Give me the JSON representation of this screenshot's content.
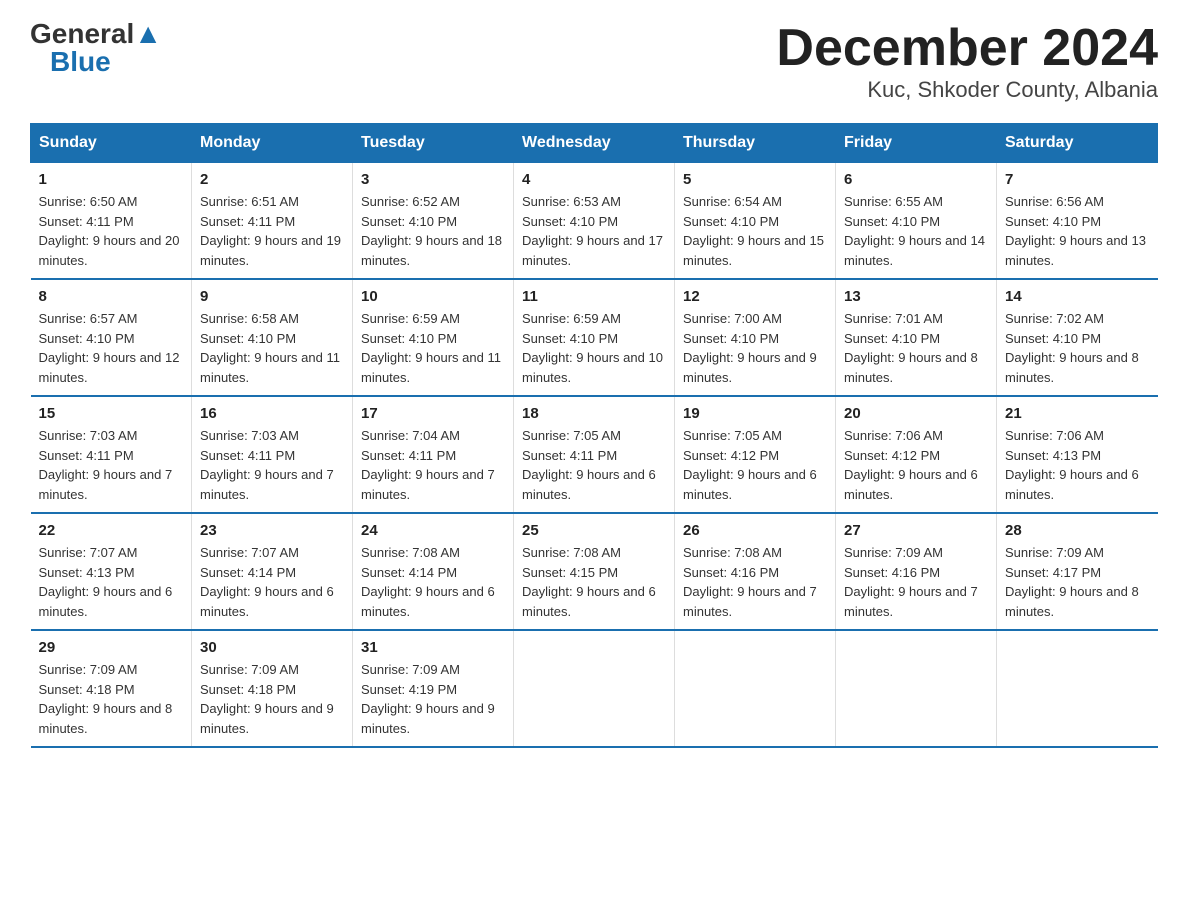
{
  "header": {
    "logo_general": "General",
    "logo_blue": "Blue",
    "title": "December 2024",
    "subtitle": "Kuc, Shkoder County, Albania"
  },
  "days_of_week": [
    "Sunday",
    "Monday",
    "Tuesday",
    "Wednesday",
    "Thursday",
    "Friday",
    "Saturday"
  ],
  "weeks": [
    [
      {
        "day": "1",
        "sunrise": "6:50 AM",
        "sunset": "4:11 PM",
        "daylight": "9 hours and 20 minutes."
      },
      {
        "day": "2",
        "sunrise": "6:51 AM",
        "sunset": "4:11 PM",
        "daylight": "9 hours and 19 minutes."
      },
      {
        "day": "3",
        "sunrise": "6:52 AM",
        "sunset": "4:10 PM",
        "daylight": "9 hours and 18 minutes."
      },
      {
        "day": "4",
        "sunrise": "6:53 AM",
        "sunset": "4:10 PM",
        "daylight": "9 hours and 17 minutes."
      },
      {
        "day": "5",
        "sunrise": "6:54 AM",
        "sunset": "4:10 PM",
        "daylight": "9 hours and 15 minutes."
      },
      {
        "day": "6",
        "sunrise": "6:55 AM",
        "sunset": "4:10 PM",
        "daylight": "9 hours and 14 minutes."
      },
      {
        "day": "7",
        "sunrise": "6:56 AM",
        "sunset": "4:10 PM",
        "daylight": "9 hours and 13 minutes."
      }
    ],
    [
      {
        "day": "8",
        "sunrise": "6:57 AM",
        "sunset": "4:10 PM",
        "daylight": "9 hours and 12 minutes."
      },
      {
        "day": "9",
        "sunrise": "6:58 AM",
        "sunset": "4:10 PM",
        "daylight": "9 hours and 11 minutes."
      },
      {
        "day": "10",
        "sunrise": "6:59 AM",
        "sunset": "4:10 PM",
        "daylight": "9 hours and 11 minutes."
      },
      {
        "day": "11",
        "sunrise": "6:59 AM",
        "sunset": "4:10 PM",
        "daylight": "9 hours and 10 minutes."
      },
      {
        "day": "12",
        "sunrise": "7:00 AM",
        "sunset": "4:10 PM",
        "daylight": "9 hours and 9 minutes."
      },
      {
        "day": "13",
        "sunrise": "7:01 AM",
        "sunset": "4:10 PM",
        "daylight": "9 hours and 8 minutes."
      },
      {
        "day": "14",
        "sunrise": "7:02 AM",
        "sunset": "4:10 PM",
        "daylight": "9 hours and 8 minutes."
      }
    ],
    [
      {
        "day": "15",
        "sunrise": "7:03 AM",
        "sunset": "4:11 PM",
        "daylight": "9 hours and 7 minutes."
      },
      {
        "day": "16",
        "sunrise": "7:03 AM",
        "sunset": "4:11 PM",
        "daylight": "9 hours and 7 minutes."
      },
      {
        "day": "17",
        "sunrise": "7:04 AM",
        "sunset": "4:11 PM",
        "daylight": "9 hours and 7 minutes."
      },
      {
        "day": "18",
        "sunrise": "7:05 AM",
        "sunset": "4:11 PM",
        "daylight": "9 hours and 6 minutes."
      },
      {
        "day": "19",
        "sunrise": "7:05 AM",
        "sunset": "4:12 PM",
        "daylight": "9 hours and 6 minutes."
      },
      {
        "day": "20",
        "sunrise": "7:06 AM",
        "sunset": "4:12 PM",
        "daylight": "9 hours and 6 minutes."
      },
      {
        "day": "21",
        "sunrise": "7:06 AM",
        "sunset": "4:13 PM",
        "daylight": "9 hours and 6 minutes."
      }
    ],
    [
      {
        "day": "22",
        "sunrise": "7:07 AM",
        "sunset": "4:13 PM",
        "daylight": "9 hours and 6 minutes."
      },
      {
        "day": "23",
        "sunrise": "7:07 AM",
        "sunset": "4:14 PM",
        "daylight": "9 hours and 6 minutes."
      },
      {
        "day": "24",
        "sunrise": "7:08 AM",
        "sunset": "4:14 PM",
        "daylight": "9 hours and 6 minutes."
      },
      {
        "day": "25",
        "sunrise": "7:08 AM",
        "sunset": "4:15 PM",
        "daylight": "9 hours and 6 minutes."
      },
      {
        "day": "26",
        "sunrise": "7:08 AM",
        "sunset": "4:16 PM",
        "daylight": "9 hours and 7 minutes."
      },
      {
        "day": "27",
        "sunrise": "7:09 AM",
        "sunset": "4:16 PM",
        "daylight": "9 hours and 7 minutes."
      },
      {
        "day": "28",
        "sunrise": "7:09 AM",
        "sunset": "4:17 PM",
        "daylight": "9 hours and 8 minutes."
      }
    ],
    [
      {
        "day": "29",
        "sunrise": "7:09 AM",
        "sunset": "4:18 PM",
        "daylight": "9 hours and 8 minutes."
      },
      {
        "day": "30",
        "sunrise": "7:09 AM",
        "sunset": "4:18 PM",
        "daylight": "9 hours and 9 minutes."
      },
      {
        "day": "31",
        "sunrise": "7:09 AM",
        "sunset": "4:19 PM",
        "daylight": "9 hours and 9 minutes."
      },
      null,
      null,
      null,
      null
    ]
  ]
}
